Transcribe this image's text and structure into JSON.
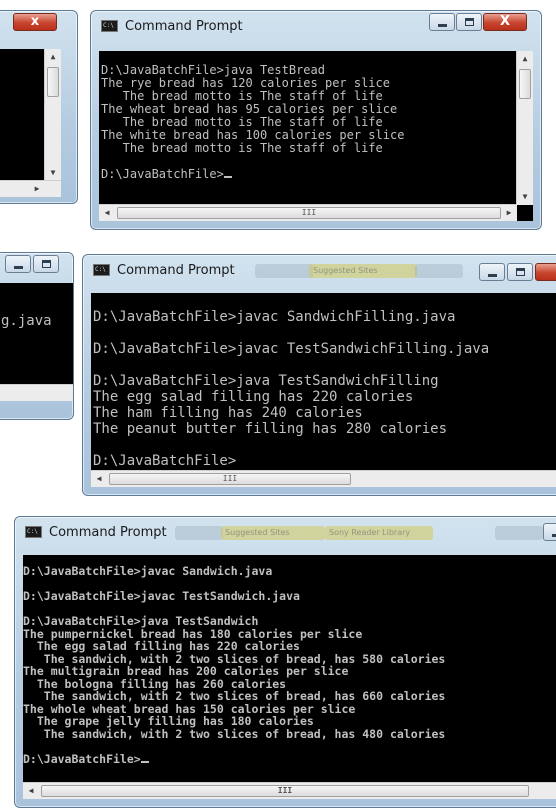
{
  "window_title": "Command Prompt",
  "prompt": "D:\\JavaBatchFile>",
  "left_top": {
    "close_glyph": "x"
  },
  "left_middle": {
    "text_fragment": "g.java"
  },
  "bread": {
    "title": "Command Prompt",
    "lines": [
      "D:\\JavaBatchFile>java TestBread",
      "The rye bread has 120 calories per slice",
      "   The bread motto is The staff of life",
      "The wheat bread has 95 calories per slice",
      "   The bread motto is The staff of life",
      "The white bread has 100 calories per slice",
      "   The bread motto is The staff of life",
      "",
      "D:\\JavaBatchFile>"
    ],
    "hscroll_thumb": "III"
  },
  "filling": {
    "title": "Command Prompt",
    "background_tabs": [
      "",
      "Suggested Sites",
      ""
    ],
    "lines": [
      "D:\\JavaBatchFile>javac SandwichFilling.java",
      "",
      "D:\\JavaBatchFile>javac TestSandwichFilling.java",
      "",
      "D:\\JavaBatchFile>java TestSandwichFilling",
      "The egg salad filling has 220 calories",
      "The ham filling has 240 calories",
      "The peanut butter filling has 280 calories",
      "",
      "D:\\JavaBatchFile>"
    ],
    "hscroll_thumb": "III"
  },
  "sandwich": {
    "title": "Command Prompt",
    "background_tabs": [
      "",
      "Suggested Sites",
      "Sony Reader Library",
      ""
    ],
    "lines": [
      "D:\\JavaBatchFile>javac Sandwich.java",
      "",
      "D:\\JavaBatchFile>javac TestSandwich.java",
      "",
      "D:\\JavaBatchFile>java TestSandwich",
      "The pumpernickel bread has 180 calories per slice",
      "  The egg salad filling has 220 calories",
      "   The sandwich, with 2 two slices of bread, has 580 calories",
      "The multigrain bread has 200 calories per slice",
      "  The bologna filling has 260 calories",
      "   The sandwich, with 2 two slices of bread, has 660 calories",
      "The whole wheat bread has 150 calories per slice",
      "  The grape jelly filling has 180 calories",
      "   The sandwich, with 2 two slices of bread, has 480 calories",
      "",
      "D:\\JavaBatchFile>"
    ],
    "hscroll_thumb": "III"
  }
}
